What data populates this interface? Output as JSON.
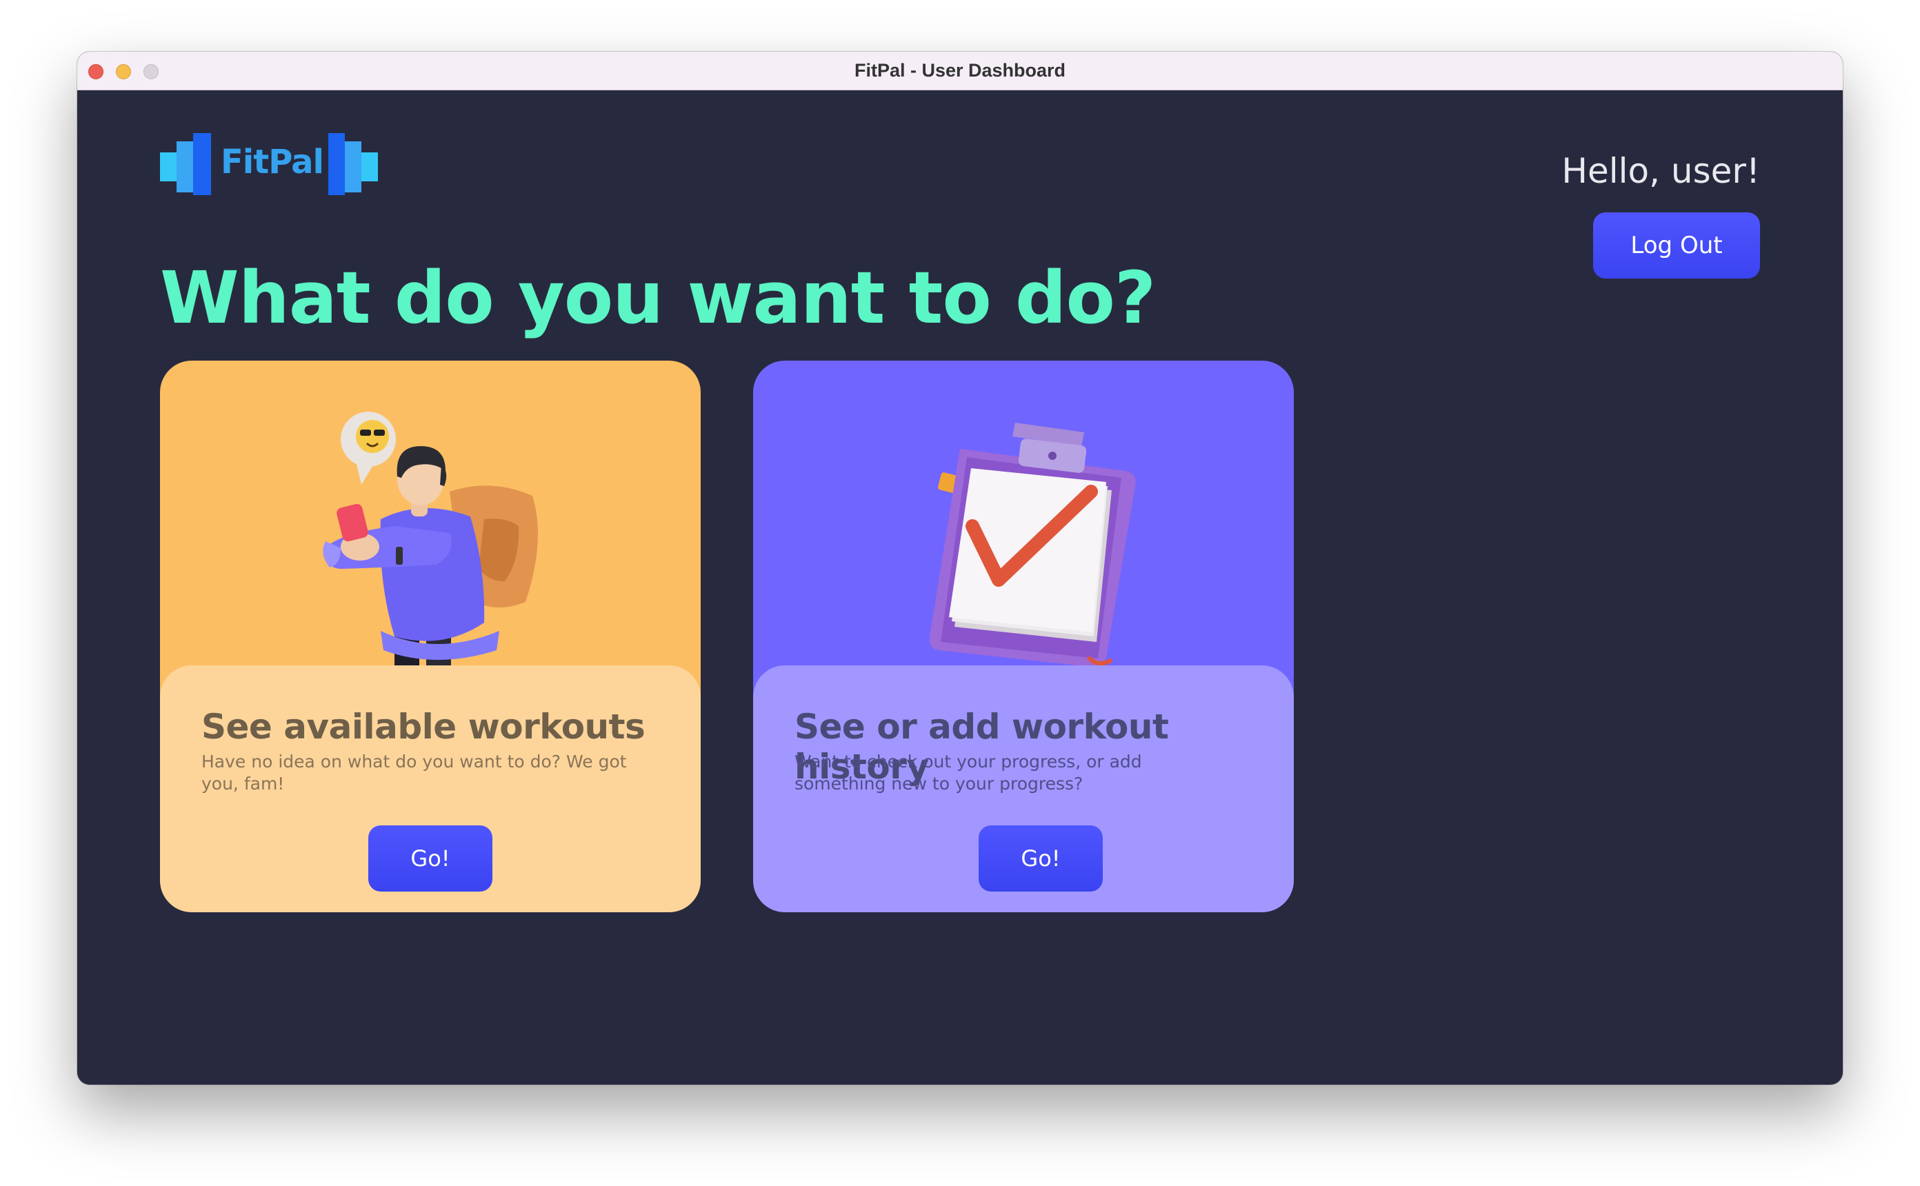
{
  "window": {
    "title": "FitPal - User Dashboard"
  },
  "header": {
    "logo_text": "FitPal",
    "greeting": "Hello, user!",
    "logout_label": "Log Out"
  },
  "main": {
    "headline": "What do you want to do?",
    "cards": [
      {
        "title": "See available workouts",
        "description": "Have no idea on what do you want to do? We got you, fam!",
        "button_label": "Go!",
        "illustration": "person-with-phone-and-backpack",
        "background": "#fcbe62"
      },
      {
        "title": "See or add workout history",
        "description": "Want to check out your progress, or add something new to your progress?",
        "button_label": "Go!",
        "illustration": "clipboard-checkmark",
        "background": "#7165ff"
      }
    ]
  },
  "colors": {
    "background": "#272a3e",
    "accent": "#5cf5c5",
    "button": "#4049f5"
  }
}
